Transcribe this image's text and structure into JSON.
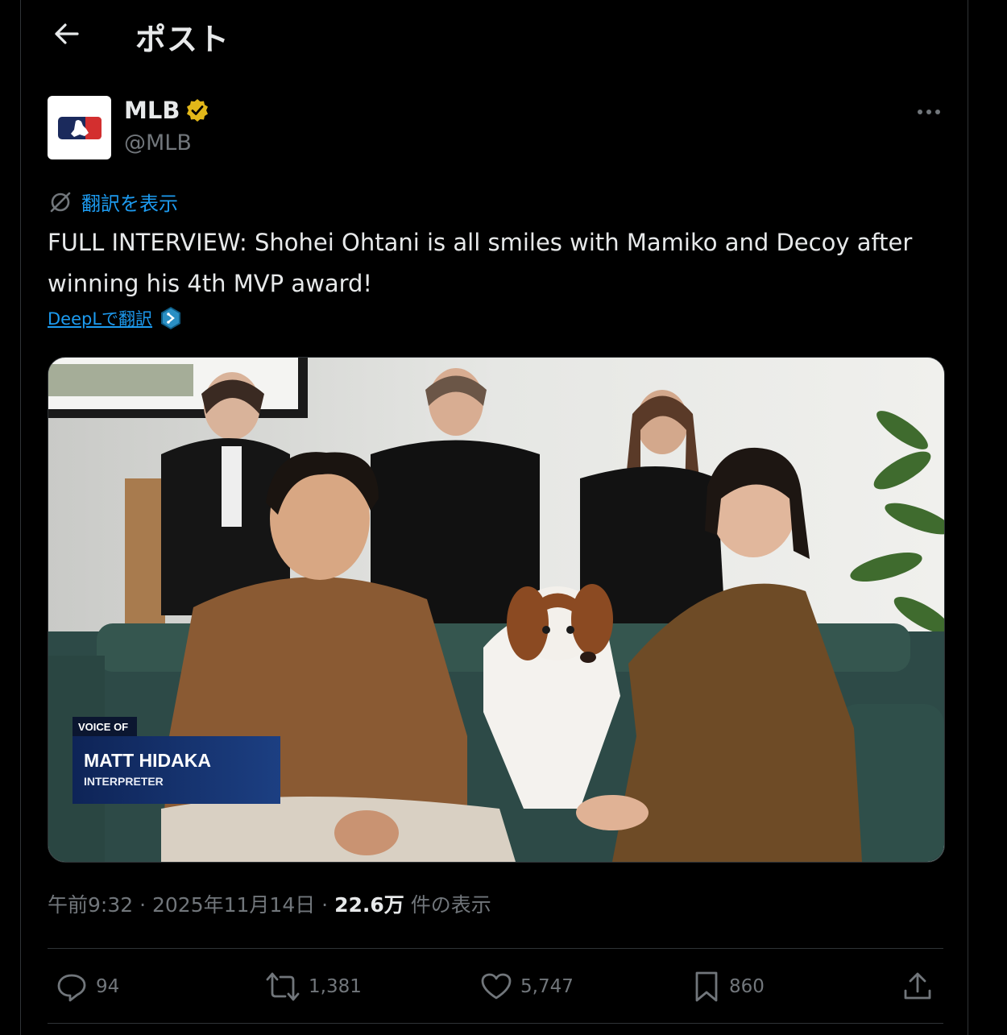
{
  "header": {
    "title": "ポスト"
  },
  "account": {
    "name": "MLB",
    "handle": "@MLB"
  },
  "translate_link": "翻訳を表示",
  "tweet": {
    "text": "FULL INTERVIEW: Shohei Ohtani is all smiles with Mamiko and Decoy after winning his 4th MVP award!",
    "deepl_label": "DeepLで翻訳"
  },
  "media": {
    "caption_kicker": "VOICE OF",
    "caption_name": "MATT HIDAKA",
    "caption_role": "INTERPRETER"
  },
  "meta": {
    "time": "午前9:32",
    "sep1": " · ",
    "date": "2025年11月14日",
    "sep2": " · ",
    "views": "22.6万",
    "views_label": " 件の表示"
  },
  "actions": {
    "replies": "94",
    "reposts": "1,381",
    "likes": "5,747",
    "bookmarks": "860"
  },
  "colors": {
    "accent": "#1d9bf0",
    "verified": "#e2b719",
    "muted": "#71767b"
  },
  "icons": [
    "back-arrow-icon",
    "verified-badge-icon",
    "more-icon",
    "translate-icon",
    "deepl-icon",
    "reply-icon",
    "repost-icon",
    "like-icon",
    "bookmark-icon",
    "share-icon"
  ]
}
